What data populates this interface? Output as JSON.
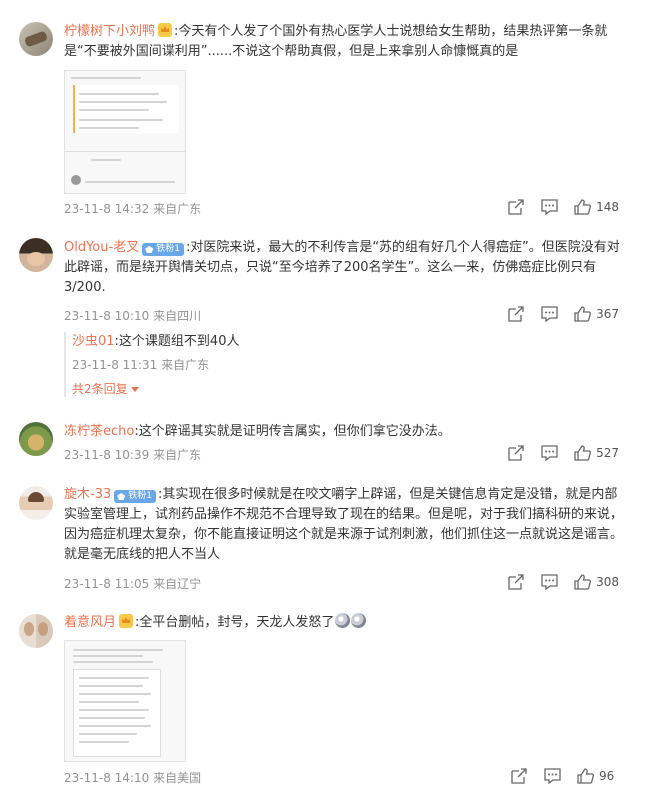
{
  "comments": [
    {
      "username": "柠檬树下小刘鸭",
      "text": ":今天有个人发了个国外有热心医学人士说想给女生帮助，结果热评第一条就是“不要被外国间谍利用”......不说这个帮助真假，但是上来拿别人命慷慨真的是",
      "time": "23-11-8 14:32",
      "location": "来自广东",
      "likes": "148"
    },
    {
      "username": "OldYou-老叉",
      "fan_badge": "铁粉1",
      "text": ":对医院来说，最大的不利传言是“苏的组有好几个人得癌症”。但医院没有对此辟谣，而是绕开舆情关切点，只说“至今培养了200名学生”。这么一来，仿佛癌症比例只有3/200.",
      "time": "23-11-8 10:10",
      "location": "来自四川",
      "likes": "367",
      "reply": {
        "username": "沙虫01",
        "text": ":这个课题组不到40人",
        "time": "23-11-8 11:31",
        "location": "来自广东",
        "more": "共2条回复"
      }
    },
    {
      "username": "冻柠茶echo",
      "text": ":这个辟谣其实就是证明传言属实，但你们拿它没办法。",
      "time": "23-11-8 10:39",
      "location": "来自广东",
      "likes": "527"
    },
    {
      "username": "旋木-33",
      "fan_badge": "铁粉1",
      "text": ":其实现在很多时候就是在咬文嚼字上辟谣，但是关键信息肯定是没错，就是内部实验室管理上，试剂药品操作不规范不合理导致了现在的结果。但是呢，对于我们搞科研的来说，因为癌症机理太复杂，你不能直接证明这个就是来源于试剂刺激，他们抓住这一点就说这是谣言。就是毫无底线的把人不当人",
      "time": "23-11-8 11:05",
      "location": "来自辽宁",
      "likes": "308"
    },
    {
      "username": "着意风月",
      "text": ":全平台删帖，封号，天龙人发怒了",
      "time": "23-11-8 14:10",
      "location": "来自美国",
      "likes": "96"
    }
  ],
  "icons": {
    "share": "share-icon",
    "comment": "comment-icon",
    "like": "like-icon",
    "crown": "crown-badge-icon",
    "fan": "fan-badge-icon",
    "dropdown": "triangle-down-icon",
    "emoji": "sad-emoji-icon"
  },
  "colors": {
    "username": "#eb7350",
    "meta": "#939393",
    "text": "#333333",
    "fan_badge": "#6aa7e8",
    "crown_badge": "#f7c948"
  }
}
